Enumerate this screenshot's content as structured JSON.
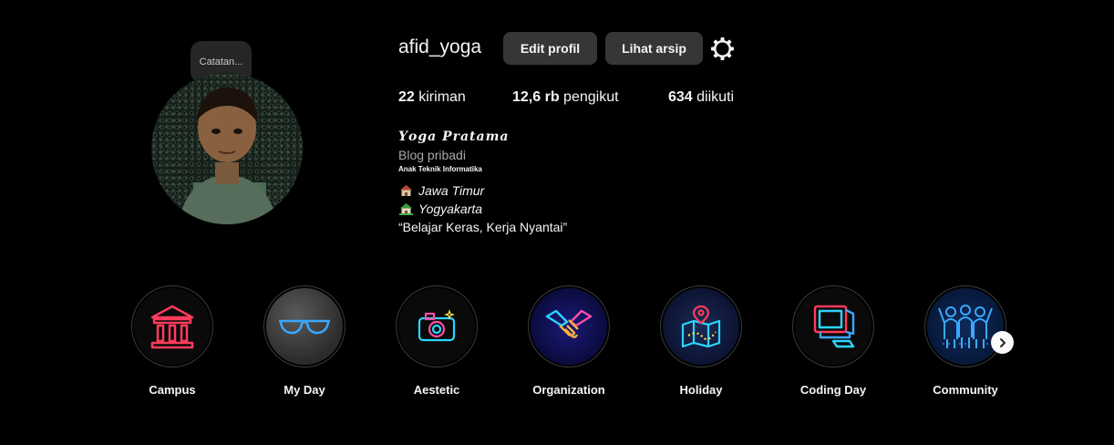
{
  "note": {
    "text": "Catatan..."
  },
  "profile": {
    "username": "afid_yoga",
    "edit_label": "Edit profil",
    "archive_label": "Lihat arsip",
    "settings_icon": "gear-icon"
  },
  "stats": {
    "posts_count": "22",
    "posts_label": "kiriman",
    "followers_count": "12,6 rb",
    "followers_label": "pengikut",
    "following_count": "634",
    "following_label": "diikuti"
  },
  "bio": {
    "full_name": "𝒀𝒐𝒈𝒂 𝑷𝒓𝒂𝒕𝒂𝒎𝒂",
    "category": "Blog pribadi",
    "line_small": "Anak Teknik Informatika",
    "origin": "Jawa Timur",
    "current": "Yogyakarta",
    "quote": "“Belajar Keras, Kerja Nyantai”"
  },
  "highlights": [
    {
      "label": "Campus",
      "icon": "building-icon"
    },
    {
      "label": "My Day",
      "icon": "sunglasses-icon"
    },
    {
      "label": "Aestetic",
      "icon": "camera-icon"
    },
    {
      "label": "Organization",
      "icon": "handshake-icon"
    },
    {
      "label": "Holiday",
      "icon": "map-icon"
    },
    {
      "label": "Coding Day",
      "icon": "computer-icon"
    },
    {
      "label": "Community",
      "icon": "people-icon"
    }
  ],
  "colors": {
    "background": "#000000",
    "button": "#363636",
    "muted_text": "#a8a8a8",
    "neon_red": "#ff3b5c",
    "neon_blue": "#3aa8ff",
    "neon_cyan": "#29d6ff"
  }
}
